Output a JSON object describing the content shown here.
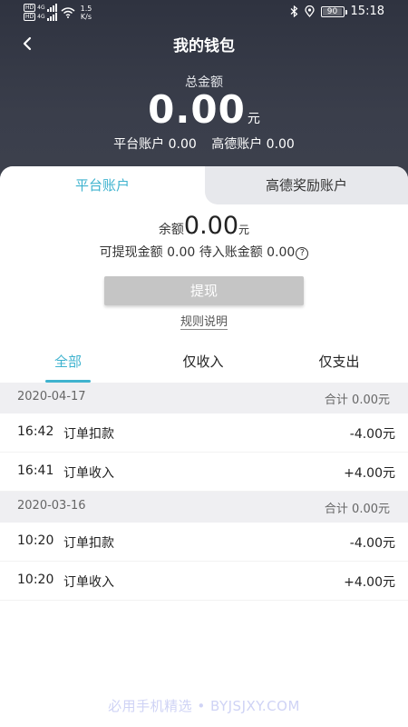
{
  "status_bar": {
    "sim1_tag": "HD",
    "sim1_net": "4G",
    "sim2_tag": "HD",
    "sim2_net": "4G",
    "speed_value": "1.5",
    "speed_unit": "K/s",
    "battery": "90",
    "time": "15:18",
    "icons": [
      "signal-icon",
      "wifi-icon",
      "bluetooth-icon",
      "location-icon",
      "battery-icon"
    ]
  },
  "nav": {
    "title": "我的钱包",
    "back_icon": "chevron-left-icon"
  },
  "summary": {
    "total_label": "总金额",
    "total_value": "0.00",
    "total_unit": "元",
    "platform_account": "平台账户 0.00",
    "gaode_account": "高德账户 0.00"
  },
  "account_tabs": [
    {
      "label": "平台账户",
      "active": true
    },
    {
      "label": "高德奖励账户",
      "active": false
    }
  ],
  "balance": {
    "label": "余额",
    "value": "0.00",
    "unit": "元",
    "withdrawable": "可提现金额 0.00",
    "pending": "待入账金额 0.00",
    "help_icon": "?"
  },
  "actions": {
    "withdraw_label": "提现",
    "rules_label": "规则说明"
  },
  "filter_tabs": [
    {
      "label": "全部",
      "active": true
    },
    {
      "label": "仅收入",
      "active": false
    },
    {
      "label": "仅支出",
      "active": false
    }
  ],
  "groups": [
    {
      "date": "2020-04-17",
      "total": "合计 0.00元",
      "items": [
        {
          "time": "16:42",
          "desc": "订单扣款",
          "amount": "-4.00元"
        },
        {
          "time": "16:41",
          "desc": "订单收入",
          "amount": "+4.00元"
        }
      ]
    },
    {
      "date": "2020-03-16",
      "total": "合计 0.00元",
      "items": [
        {
          "time": "10:20",
          "desc": "订单扣款",
          "amount": "-4.00元"
        },
        {
          "time": "10:20",
          "desc": "订单收入",
          "amount": "+4.00元"
        }
      ]
    }
  ],
  "watermark": "必用手机精选 • BYJSJXY.COM",
  "colors": {
    "accent": "#3fb3cf",
    "header_bg": "#363a46",
    "button_disabled": "#c5c5c5",
    "date_row_bg": "#efeff2"
  }
}
